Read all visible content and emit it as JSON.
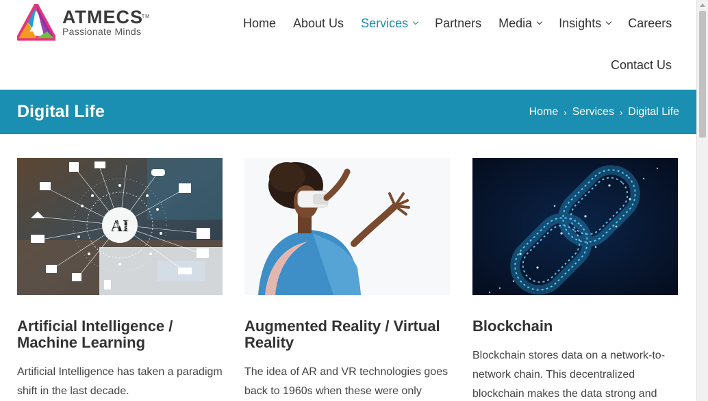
{
  "brand": {
    "name": "ATMECS",
    "trademark": "TM",
    "tagline": "Passionate Minds"
  },
  "nav": {
    "items": [
      {
        "label": "Home",
        "has_dropdown": false
      },
      {
        "label": "About Us",
        "has_dropdown": false
      },
      {
        "label": "Services",
        "has_dropdown": true,
        "active": true
      },
      {
        "label": "Partners",
        "has_dropdown": false
      },
      {
        "label": "Media",
        "has_dropdown": true
      },
      {
        "label": "Insights",
        "has_dropdown": true
      },
      {
        "label": "Careers",
        "has_dropdown": false
      }
    ],
    "contact": "Contact Us"
  },
  "banner": {
    "title": "Digital Life",
    "breadcrumb": [
      "Home",
      "Services",
      "Digital Life"
    ],
    "separator": "›",
    "color": "#1b8fb1"
  },
  "cards": [
    {
      "title": "Artificial Intelligence / Machine Learning",
      "text": "Artificial Intelligence has taken a paradigm shift in the last decade.",
      "image": "ai-network-image"
    },
    {
      "title": "Augmented Reality / Virtual Reality",
      "text": "The idea of AR and VR technologies goes back to 1960s when these were only",
      "image": "vr-headset-image"
    },
    {
      "title": "Blockchain",
      "text": "Blockchain stores data on a network-to-network chain. This decentralized blockchain makes the data strong and",
      "image": "blockchain-chain-image"
    }
  ],
  "colors": {
    "accent": "#1b8fb1",
    "nav_active": "#1a8fb0",
    "text": "#333333"
  }
}
